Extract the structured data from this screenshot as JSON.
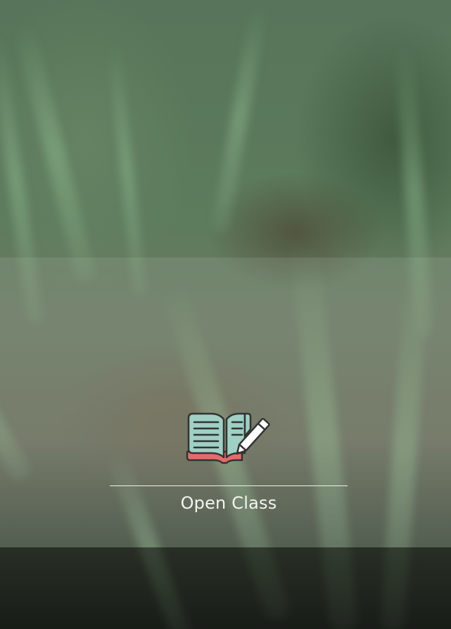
{
  "background": {
    "description_icon": "blurred-green-onion-field-photo",
    "band_color": "#c8cdc3",
    "bottom_band_color": "#141612"
  },
  "open_class": {
    "icon": "open-book-with-pencil-icon",
    "label": "Open Class",
    "label_color": "#f4f4f0",
    "colors": {
      "page": "#9fd0c3",
      "cover": "#e56b6b",
      "outline": "#333333",
      "pencil": "#ffffff"
    }
  }
}
